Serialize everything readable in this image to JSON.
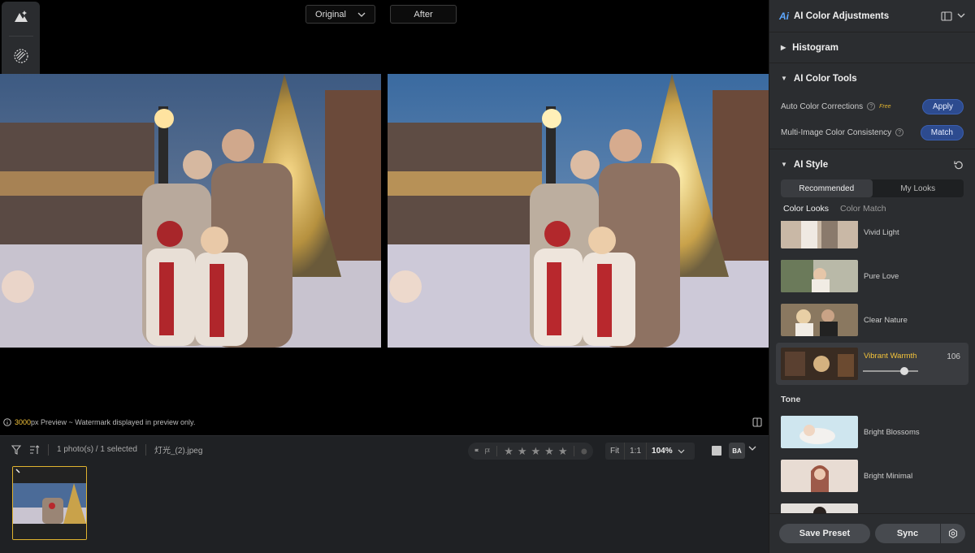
{
  "viewer": {
    "original_label": "Original",
    "after_label": "After",
    "watermark_px": "3000",
    "watermark_text": "px Preview ~ Watermark displayed in preview only."
  },
  "rail": {
    "icons": [
      "adjust-icon",
      "noise-icon",
      "history-icon"
    ]
  },
  "bottom": {
    "photo_count": "1 photo(s) / 1 selected",
    "filename": "灯光_(2).jpeg",
    "zoom_fit": "Fit",
    "zoom_1to1": "1:1",
    "zoom_value": "104%",
    "ba_label": "BA",
    "stars": [
      "★",
      "★",
      "★",
      "★",
      "★"
    ]
  },
  "panel": {
    "title": "AI Color Adjustments",
    "ai_badge": "Ai",
    "histogram": "Histogram",
    "color_tools": "AI Color Tools",
    "auto_color": "Auto Color Corrections",
    "free_badge": "Free",
    "apply": "Apply",
    "multi_image": "Multi-Image Color Consistency",
    "match": "Match",
    "ai_style": "AI Style",
    "tab_recommended": "Recommended",
    "tab_my_looks": "My Looks",
    "subtab_color_looks": "Color Looks",
    "subtab_color_match": "Color Match",
    "looks": [
      {
        "name": "Vivid Light"
      },
      {
        "name": "Pure Love"
      },
      {
        "name": "Clear Nature"
      },
      {
        "name": "Vibrant Warmth",
        "value": "106",
        "intensity": 0.75
      },
      {
        "name": "Bright Blossoms"
      },
      {
        "name": "Bright Minimal"
      }
    ],
    "tone_label": "Tone",
    "save_preset": "Save Preset",
    "sync": "Sync"
  },
  "colors": {
    "accent": "#f3c33a",
    "button_blue": "#2d4b8f",
    "panel_bg": "#2b2d30"
  }
}
